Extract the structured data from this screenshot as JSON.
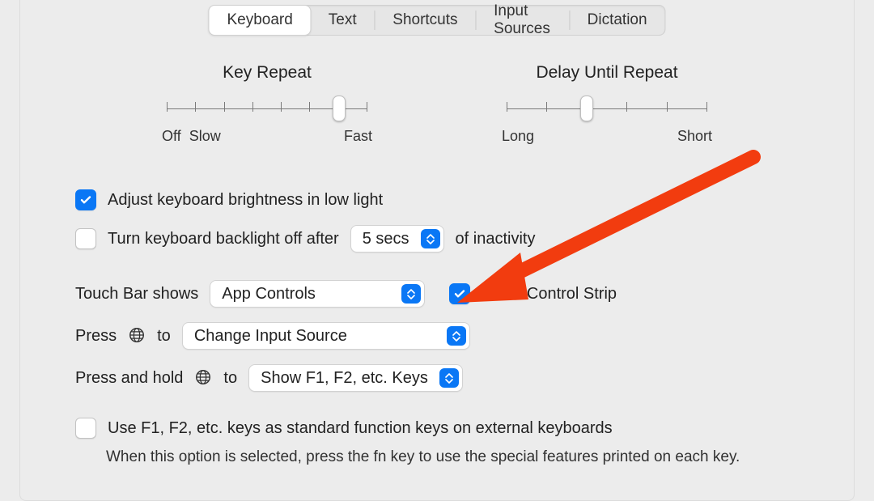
{
  "tabs": {
    "keyboard": "Keyboard",
    "text": "Text",
    "shortcuts": "Shortcuts",
    "input_sources": "Input Sources",
    "dictation": "Dictation",
    "active": "keyboard"
  },
  "sliders": {
    "key_repeat": {
      "title": "Key Repeat",
      "left_label_a": "Off",
      "left_label_b": "Slow",
      "right_label": "Fast",
      "ticks": 8,
      "value_index": 6
    },
    "delay_until_repeat": {
      "title": "Delay Until Repeat",
      "left_label": "Long",
      "right_label": "Short",
      "ticks": 6,
      "value_index": 2
    }
  },
  "checkboxes": {
    "adjust_brightness": {
      "label": "Adjust keyboard brightness in low light",
      "checked": true
    },
    "backlight_off": {
      "prefix": "Turn keyboard backlight off after",
      "suffix": "of inactivity",
      "checked": false,
      "select_value": "5 secs"
    },
    "show_control_strip": {
      "label": "Show Control Strip",
      "checked": true
    },
    "fn_keys": {
      "label": "Use F1, F2, etc. keys as standard function keys on external keyboards",
      "note": "When this option is selected, press the fn key to use the special features printed on each key.",
      "checked": false
    }
  },
  "touch_bar": {
    "prefix": "Touch Bar shows",
    "value": "App Controls"
  },
  "press_globe": {
    "prefix_a": "Press",
    "prefix_b": "to",
    "value": "Change Input Source"
  },
  "press_hold_globe": {
    "prefix_a": "Press and hold",
    "prefix_b": "to",
    "value": "Show F1, F2, etc. Keys"
  },
  "colors": {
    "accent": "#0a77f5",
    "annotation": "#f23c0f"
  }
}
